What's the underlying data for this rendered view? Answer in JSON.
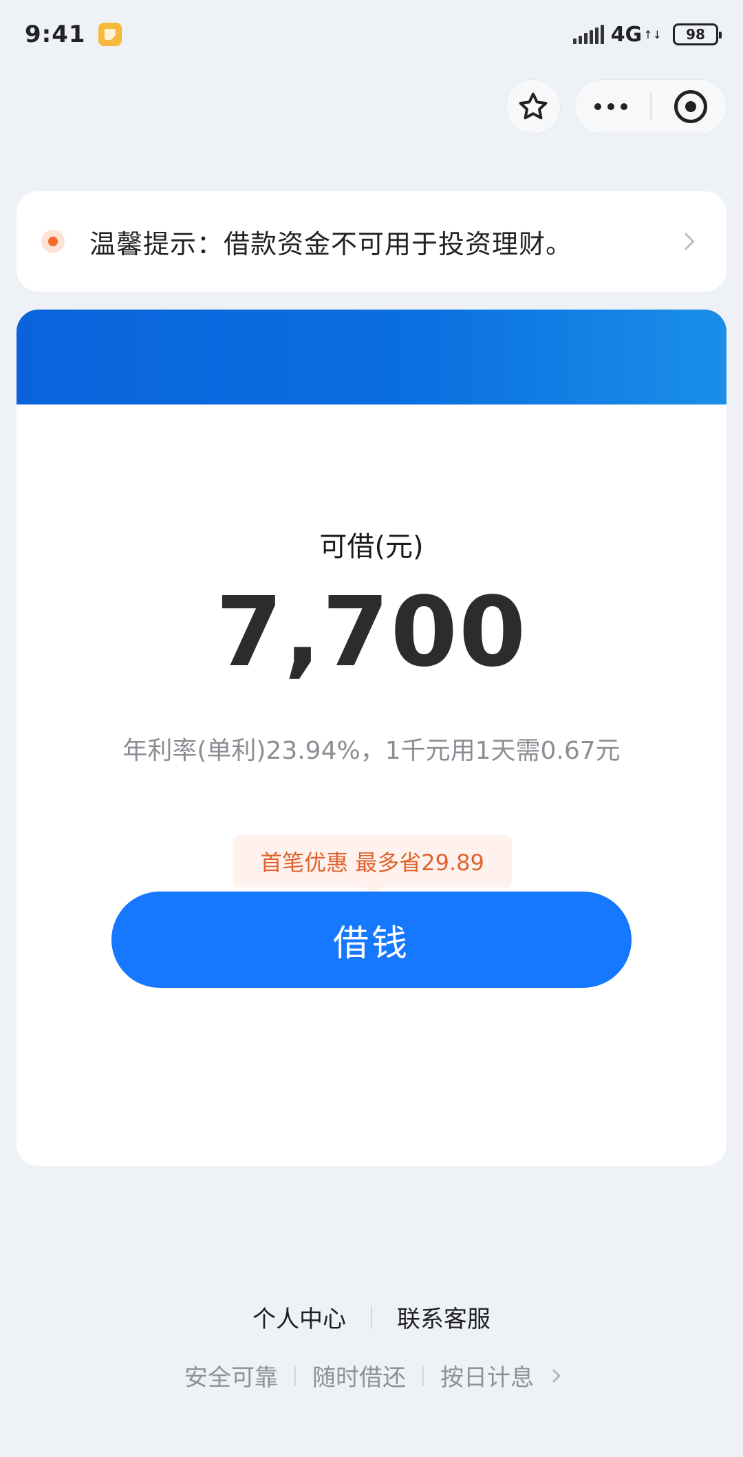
{
  "status_bar": {
    "time": "9:41",
    "network": "4G",
    "network_arrows": "↑↓",
    "battery": "98"
  },
  "notice": {
    "text": "温馨提示：借款资金不可用于投资理财。"
  },
  "card": {
    "label": "可借(元)",
    "amount": "7,700",
    "rate": "年利率(单利)23.94%，1千元用1天需0.67元",
    "promo": "首笔优惠 最多省29.89",
    "button": "借钱"
  },
  "footer": {
    "links": [
      "个人中心",
      "联系客服"
    ],
    "tags": [
      "安全可靠",
      "随时借还",
      "按日计息"
    ]
  },
  "colors": {
    "primary": "#1677ff",
    "banner": "#0b63db",
    "promo_text": "#e0632d",
    "notice_dot": "#f26b2a",
    "background": "#eef2f7"
  }
}
